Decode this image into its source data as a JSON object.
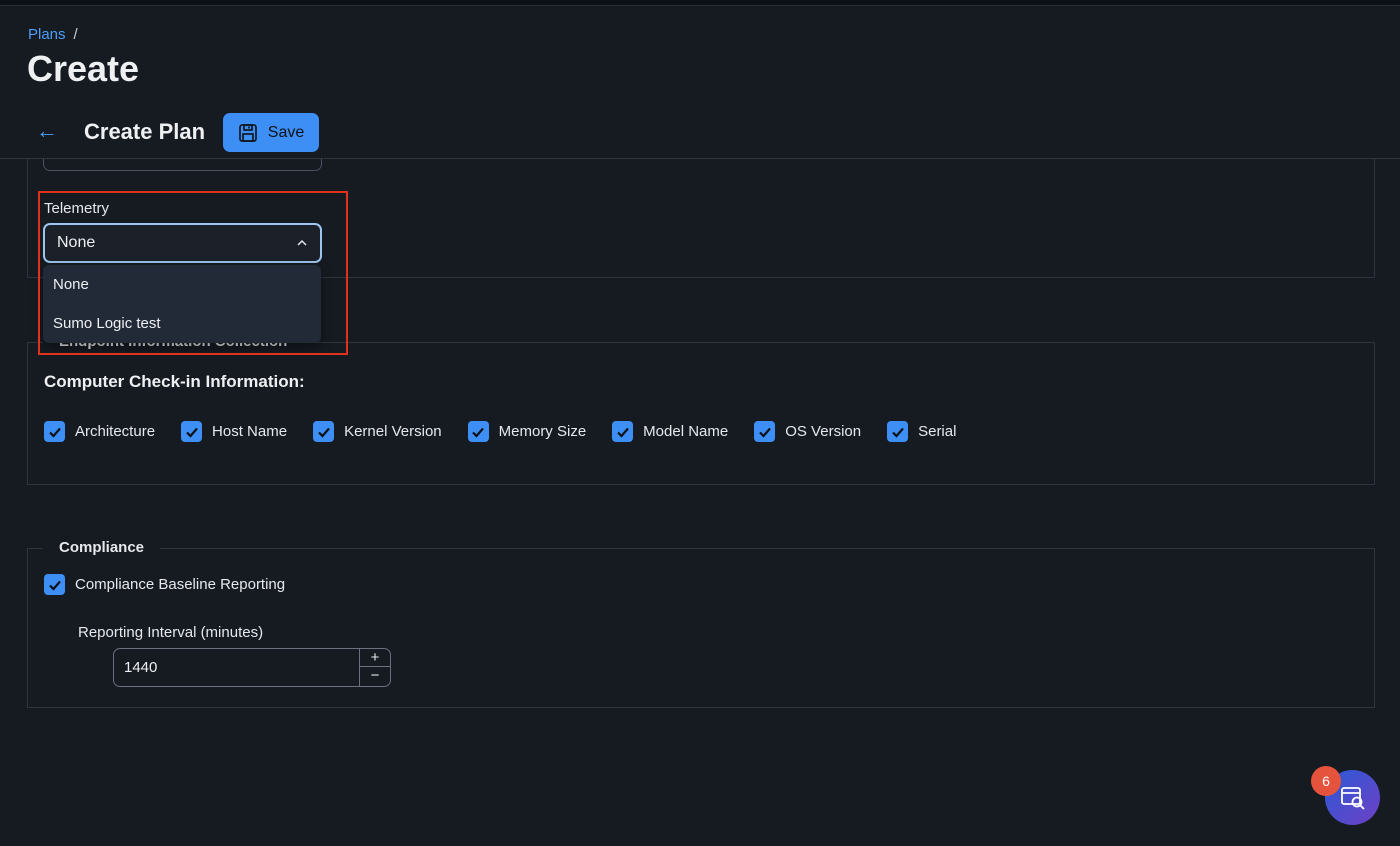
{
  "breadcrumb": {
    "link": "Plans",
    "separator": "/"
  },
  "page_title": "Create",
  "toolbar": {
    "title": "Create Plan",
    "save_label": "Save",
    "back_icon": "arrow-left-icon",
    "save_icon": "floppy-disk-icon"
  },
  "telemetry": {
    "label": "Telemetry",
    "selected": "None",
    "options": [
      "None",
      "Sumo Logic test"
    ]
  },
  "endpoint": {
    "legend": "Endpoint Information Collection",
    "heading": "Computer Check-in Information:",
    "checkboxes": [
      {
        "label": "Architecture",
        "checked": true
      },
      {
        "label": "Host Name",
        "checked": true
      },
      {
        "label": "Kernel Version",
        "checked": true
      },
      {
        "label": "Memory Size",
        "checked": true
      },
      {
        "label": "Model Name",
        "checked": true
      },
      {
        "label": "OS Version",
        "checked": true
      },
      {
        "label": "Serial",
        "checked": true
      }
    ]
  },
  "compliance": {
    "legend": "Compliance",
    "baseline_label": "Compliance Baseline Reporting",
    "baseline_checked": true,
    "interval_label": "Reporting Interval (minutes)",
    "interval_value": "1440",
    "increment": "+",
    "decrement": "−"
  },
  "fab": {
    "badge_count": "6",
    "icon": "search-window-icon"
  },
  "colors": {
    "accent": "#3d8ff5",
    "link": "#4c9ef8",
    "highlight": "#e2321e",
    "badge": "#e5533c",
    "background": "#161b22"
  }
}
